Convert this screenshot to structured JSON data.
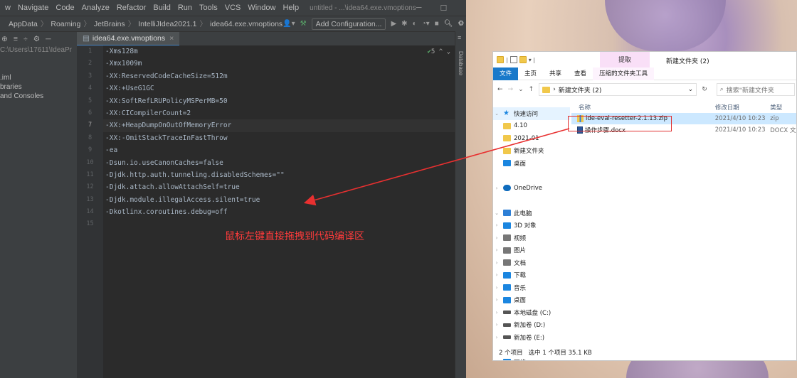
{
  "ide": {
    "menu": [
      {
        "label": "w"
      },
      {
        "label": "Navigate"
      },
      {
        "label": "Code"
      },
      {
        "label": "Analyze"
      },
      {
        "label": "Refactor"
      },
      {
        "label": "Build"
      },
      {
        "label": "Run"
      },
      {
        "label": "Tools"
      },
      {
        "label": "VCS"
      },
      {
        "label": "Window"
      },
      {
        "label": "Help"
      }
    ],
    "window_title": "untitled - ...\\idea64.exe.vmoptions",
    "breadcrumbs": [
      "AppData",
      "Roaming",
      "JetBrains",
      "IntelliJIdea2021.1",
      "idea64.exe.vmoptions"
    ],
    "add_configuration": "Add Configuration...",
    "file_tab": "idea64.exe.vmoptions",
    "project_items": [
      "C:\\Users\\17611\\IdeaPr",
      ".iml",
      "braries",
      "and Consoles"
    ],
    "line_numbers": [
      "1",
      "2",
      "3",
      "4",
      "5",
      "6",
      "7",
      "8",
      "9",
      "10",
      "11",
      "12",
      "13",
      "14",
      "15"
    ],
    "code_lines": [
      "-Xms128m",
      "-Xmx1009m",
      "-XX:ReservedCodeCacheSize=512m",
      "-XX:+UseG1GC",
      "-XX:SoftRefLRUPolicyMSPerMB=50",
      "-XX:CICompilerCount=2",
      "-XX:+HeapDumpOnOutOfMemoryError",
      "-XX:-OmitStackTraceInFastThrow",
      "-ea",
      "-Dsun.io.useCanonCaches=false",
      "-Djdk.http.auth.tunneling.disabledSchemes=\"\"",
      "-Djdk.attach.allowAttachSelf=true",
      "-Djdk.module.illegalAccess.silent=true",
      "-Dkotlinx.coroutines.debug=off",
      ""
    ],
    "current_line": 7,
    "inspections": "5",
    "right_tool": "Database"
  },
  "annotation": "鼠标左键直接拖拽到代码编译区",
  "explorer": {
    "context_tab": "提取",
    "window_title": "新建文件夹 (2)",
    "ribbon": [
      "文件",
      "主页",
      "共享",
      "查看",
      "压缩的文件夹工具"
    ],
    "path": "新建文件夹 (2)",
    "search_placeholder": "搜索\"新建文件夹",
    "columns": {
      "name": "名称",
      "date": "修改日期",
      "type": "类型"
    },
    "nav_items": [
      {
        "label": "快速访问",
        "icon": "star-icon",
        "sel": true
      },
      {
        "label": "4.10",
        "icon": "folder-icon"
      },
      {
        "label": "2021-01",
        "icon": "folder-icon"
      },
      {
        "label": "新建文件夹",
        "icon": "folder-icon"
      },
      {
        "label": "桌面",
        "icon": "desktop-icon"
      },
      {
        "label": "",
        "icon": ""
      },
      {
        "label": "OneDrive",
        "icon": "cloud-icon"
      },
      {
        "label": "",
        "icon": ""
      },
      {
        "label": "此电脑",
        "icon": "pc-icon"
      },
      {
        "label": "3D 对象",
        "icon": "cube-icon"
      },
      {
        "label": "视频",
        "icon": "video-icon"
      },
      {
        "label": "图片",
        "icon": "picture-icon"
      },
      {
        "label": "文档",
        "icon": "document-icon"
      },
      {
        "label": "下载",
        "icon": "download-icon"
      },
      {
        "label": "音乐",
        "icon": "music-icon"
      },
      {
        "label": "桌面",
        "icon": "desktop-icon"
      },
      {
        "label": "本地磁盘 (C:)",
        "icon": "drive-icon"
      },
      {
        "label": "新加卷 (D:)",
        "icon": "drive-icon"
      },
      {
        "label": "新加卷 (E:)",
        "icon": "drive-icon"
      },
      {
        "label": "",
        "icon": ""
      },
      {
        "label": "网络",
        "icon": "network-icon"
      }
    ],
    "files": [
      {
        "name": "ide-eval-resetter-2.1.13.zip",
        "date": "2021/4/10 10:23",
        "type": "zip"
      },
      {
        "name": "操作步骤.docx",
        "date": "2021/4/10 10:23",
        "type": "DOCX 文"
      }
    ],
    "status": [
      "2 个项目",
      "选中 1 个项目 35.1 KB"
    ]
  },
  "colors": {
    "ide_bg": "#2b2b2b",
    "accent": "#1979ca",
    "annotation": "#ff3b3b"
  }
}
